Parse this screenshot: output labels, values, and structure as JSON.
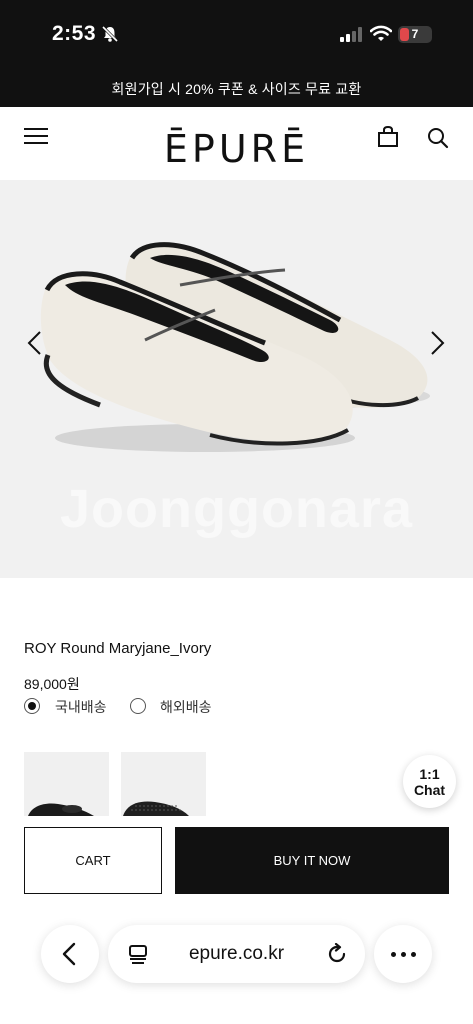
{
  "status_bar": {
    "time": "2:53",
    "battery": "7",
    "icons": [
      "bell-slash-icon",
      "signal-icon",
      "wifi-icon",
      "battery-icon"
    ]
  },
  "promo_banner": "회원가입 시 20% 쿠폰 & 사이즈 무료 교환",
  "header": {
    "logo": "ĒPURĒ",
    "icons": [
      "menu-icon",
      "shopping-bag-icon",
      "search-icon"
    ]
  },
  "hero": {
    "watermark": "Joonggonara"
  },
  "product": {
    "name": "ROY Round Maryjane_Ivory",
    "price": "89,000원",
    "shipping_options": [
      {
        "label": "국내배송",
        "selected": true
      },
      {
        "label": "해외배송",
        "selected": false
      }
    ]
  },
  "chat": {
    "line1": "1:1",
    "line2": "Chat"
  },
  "actions": {
    "cart_label": "CART",
    "buy_label": "BUY IT NOW"
  },
  "browser": {
    "url": "epure.co.kr"
  },
  "colors": {
    "dark": "#111111",
    "hero_bg": "#f1f1f1",
    "battery_red": "#e0484b"
  }
}
